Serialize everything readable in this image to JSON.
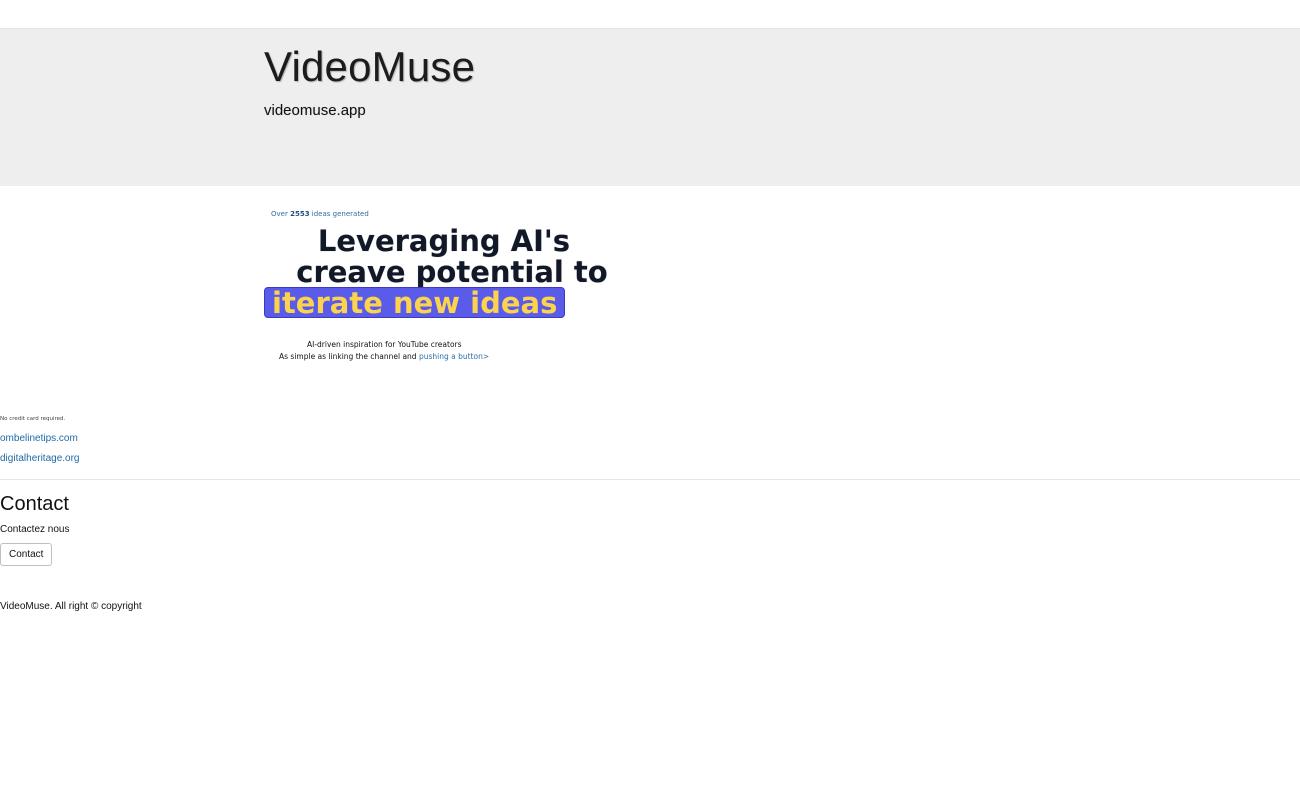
{
  "header": {
    "title": "VideoMuse",
    "domain": "videomuse.app"
  },
  "promo": {
    "counter_prefix": "Over",
    "counter_value": "2553",
    "counter_suffix": "ideas generated",
    "headline_line1": "Leveraging AI's",
    "headline_line2": "creave potential to",
    "headline_highlight": "iterate new ideas",
    "tagline1": "AI-driven inspiration for YouTube creators",
    "tagline2_prefix": "As simple as linking the channel and",
    "tagline2_link": "pushing a button>",
    "no_card": "No credit card required.",
    "highlight_bg": "#5b5bea",
    "highlight_text": "#fcd34d"
  },
  "links": [
    {
      "label": "ombelinetips.com"
    },
    {
      "label": "digitalheritage.org"
    }
  ],
  "contact": {
    "title": "Contact",
    "subtitle": "Contactez nous",
    "button_label": "Contact"
  },
  "footer": {
    "text": "VideoMuse. All right © copyright"
  }
}
